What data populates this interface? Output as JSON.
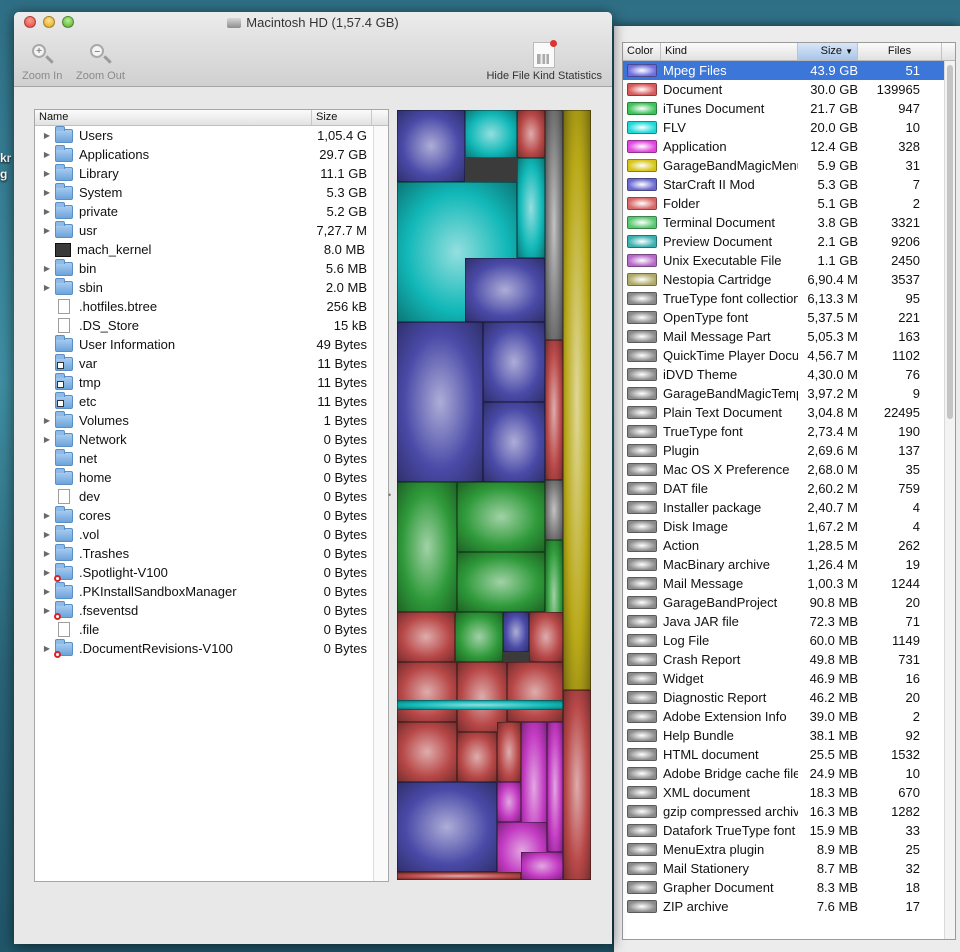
{
  "desktop": {
    "edge_text": [
      "kr",
      "g"
    ]
  },
  "window": {
    "title": "Macintosh HD (1,57.4 GB)",
    "toolbar": {
      "zoom_in": "Zoom In",
      "zoom_out": "Zoom Out",
      "hide_stats": "Hide File Kind Statistics"
    }
  },
  "outline": {
    "columns": {
      "name": "Name",
      "size": "Size"
    },
    "rows": [
      {
        "name": "Users",
        "size": "1,05.4 G",
        "icon": "folder",
        "expandable": true,
        "badge": ""
      },
      {
        "name": "Applications",
        "size": "29.7 GB",
        "icon": "folder",
        "expandable": true,
        "badge": ""
      },
      {
        "name": "Library",
        "size": "11.1 GB",
        "icon": "folder",
        "expandable": true,
        "badge": ""
      },
      {
        "name": "System",
        "size": "5.3 GB",
        "icon": "folder",
        "expandable": true,
        "badge": ""
      },
      {
        "name": "private",
        "size": "5.2 GB",
        "icon": "folder",
        "expandable": true,
        "badge": ""
      },
      {
        "name": "usr",
        "size": "7,27.7 M",
        "icon": "folder",
        "expandable": true,
        "badge": ""
      },
      {
        "name": "mach_kernel",
        "size": "8.0 MB",
        "icon": "exe",
        "expandable": false,
        "badge": ""
      },
      {
        "name": "bin",
        "size": "5.6 MB",
        "icon": "folder",
        "expandable": true,
        "badge": ""
      },
      {
        "name": "sbin",
        "size": "2.0 MB",
        "icon": "folder",
        "expandable": true,
        "badge": ""
      },
      {
        "name": ".hotfiles.btree",
        "size": "256 kB",
        "icon": "doc",
        "expandable": false,
        "badge": ""
      },
      {
        "name": ".DS_Store",
        "size": "15 kB",
        "icon": "doc",
        "expandable": false,
        "badge": ""
      },
      {
        "name": "User Information",
        "size": "49 Bytes",
        "icon": "folder",
        "expandable": false,
        "badge": ""
      },
      {
        "name": "var",
        "size": "11 Bytes",
        "icon": "folder",
        "expandable": false,
        "badge": "alias"
      },
      {
        "name": "tmp",
        "size": "11 Bytes",
        "icon": "folder",
        "expandable": false,
        "badge": "alias"
      },
      {
        "name": "etc",
        "size": "11 Bytes",
        "icon": "folder",
        "expandable": false,
        "badge": "alias"
      },
      {
        "name": "Volumes",
        "size": "1 Bytes",
        "icon": "folder",
        "expandable": true,
        "badge": ""
      },
      {
        "name": "Network",
        "size": "0 Bytes",
        "icon": "folder",
        "expandable": true,
        "badge": ""
      },
      {
        "name": "net",
        "size": "0 Bytes",
        "icon": "folder",
        "expandable": false,
        "badge": ""
      },
      {
        "name": "home",
        "size": "0 Bytes",
        "icon": "folder",
        "expandable": false,
        "badge": ""
      },
      {
        "name": "dev",
        "size": "0 Bytes",
        "icon": "doc",
        "expandable": false,
        "badge": ""
      },
      {
        "name": "cores",
        "size": "0 Bytes",
        "icon": "folder",
        "expandable": true,
        "badge": ""
      },
      {
        "name": ".vol",
        "size": "0 Bytes",
        "icon": "folder",
        "expandable": true,
        "badge": ""
      },
      {
        "name": ".Trashes",
        "size": "0 Bytes",
        "icon": "folder",
        "expandable": true,
        "badge": ""
      },
      {
        "name": ".Spotlight-V100",
        "size": "0 Bytes",
        "icon": "folder",
        "expandable": true,
        "badge": "restricted"
      },
      {
        "name": ".PKInstallSandboxManager",
        "size": "0 Bytes",
        "icon": "folder",
        "expandable": true,
        "badge": ""
      },
      {
        "name": ".fseventsd",
        "size": "0 Bytes",
        "icon": "folder",
        "expandable": true,
        "badge": "restricted"
      },
      {
        "name": ".file",
        "size": "0 Bytes",
        "icon": "doc",
        "expandable": false,
        "badge": ""
      },
      {
        "name": ".DocumentRevisions-V100",
        "size": "0 Bytes",
        "icon": "folder",
        "expandable": true,
        "badge": "restricted"
      }
    ]
  },
  "stats": {
    "columns": {
      "color": "Color",
      "kind": "Kind",
      "size": "Size",
      "files": "Files"
    },
    "rows": [
      {
        "color": "#6f6fe0",
        "kind": "Mpeg Files",
        "size": "43.9 GB",
        "files": "51",
        "selected": true
      },
      {
        "color": "#d85a5a",
        "kind": "Document",
        "size": "30.0 GB",
        "files": "139965"
      },
      {
        "color": "#3ec45a",
        "kind": "iTunes Document",
        "size": "21.7 GB",
        "files": "947"
      },
      {
        "color": "#1fd9d9",
        "kind": "FLV",
        "size": "20.0 GB",
        "files": "10"
      },
      {
        "color": "#e046e0",
        "kind": "Application",
        "size": "12.4 GB",
        "files": "328"
      },
      {
        "color": "#d6c418",
        "kind": "GarageBandMagicMenu",
        "size": "5.9 GB",
        "files": "31"
      },
      {
        "color": "#6a6ad0",
        "kind": "StarCraft II Mod",
        "size": "5.3 GB",
        "files": "7"
      },
      {
        "color": "#d86868",
        "kind": "Folder",
        "size": "5.1 GB",
        "files": "2"
      },
      {
        "color": "#58c870",
        "kind": "Terminal Document",
        "size": "3.8 GB",
        "files": "3321"
      },
      {
        "color": "#3ab0b0",
        "kind": "Preview Document",
        "size": "2.1 GB",
        "files": "9206"
      },
      {
        "color": "#b868c8",
        "kind": "Unix Executable File",
        "size": "1.1 GB",
        "files": "2450"
      },
      {
        "color": "#b0aa68",
        "kind": "Nestopia Cartridge",
        "size": "6,90.4 M",
        "files": "3537"
      },
      {
        "color": "#8a8a8a",
        "kind": "TrueType font collection",
        "size": "6,13.3 M",
        "files": "95"
      },
      {
        "color": "#8a8a8a",
        "kind": "OpenType font",
        "size": "5,37.5 M",
        "files": "221"
      },
      {
        "color": "#8a8a8a",
        "kind": "Mail Message Part",
        "size": "5,05.3 M",
        "files": "163"
      },
      {
        "color": "#8a8a8a",
        "kind": "QuickTime Player Document",
        "size": "4,56.7 M",
        "files": "1102"
      },
      {
        "color": "#8a8a8a",
        "kind": "iDVD Theme",
        "size": "4,30.0 M",
        "files": "76"
      },
      {
        "color": "#8a8a8a",
        "kind": "GarageBandMagicTemplate",
        "size": "3,97.2 M",
        "files": "9"
      },
      {
        "color": "#8a8a8a",
        "kind": "Plain Text Document",
        "size": "3,04.8 M",
        "files": "22495"
      },
      {
        "color": "#8a8a8a",
        "kind": "TrueType font",
        "size": "2,73.4 M",
        "files": "190"
      },
      {
        "color": "#8a8a8a",
        "kind": "Plugin",
        "size": "2,69.6 M",
        "files": "137"
      },
      {
        "color": "#8a8a8a",
        "kind": "Mac OS X Preference",
        "size": "2,68.0 M",
        "files": "35"
      },
      {
        "color": "#8a8a8a",
        "kind": "DAT file",
        "size": "2,60.2 M",
        "files": "759"
      },
      {
        "color": "#8a8a8a",
        "kind": "Installer package",
        "size": "2,40.7 M",
        "files": "4"
      },
      {
        "color": "#8a8a8a",
        "kind": "Disk Image",
        "size": "1,67.2 M",
        "files": "4"
      },
      {
        "color": "#8a8a8a",
        "kind": "Action",
        "size": "1,28.5 M",
        "files": "262"
      },
      {
        "color": "#8a8a8a",
        "kind": "MacBinary archive",
        "size": "1,26.4 M",
        "files": "19"
      },
      {
        "color": "#8a8a8a",
        "kind": "Mail Message",
        "size": "1,00.3 M",
        "files": "1244"
      },
      {
        "color": "#8a8a8a",
        "kind": "GarageBandProject",
        "size": "90.8 MB",
        "files": "20"
      },
      {
        "color": "#8a8a8a",
        "kind": "Java JAR file",
        "size": "72.3 MB",
        "files": "71"
      },
      {
        "color": "#8a8a8a",
        "kind": "Log File",
        "size": "60.0 MB",
        "files": "1149"
      },
      {
        "color": "#8a8a8a",
        "kind": "Crash Report",
        "size": "49.8 MB",
        "files": "731"
      },
      {
        "color": "#8a8a8a",
        "kind": "Widget",
        "size": "46.9 MB",
        "files": "16"
      },
      {
        "color": "#8a8a8a",
        "kind": "Diagnostic Report",
        "size": "46.2 MB",
        "files": "20"
      },
      {
        "color": "#8a8a8a",
        "kind": "Adobe Extension Info",
        "size": "39.0 MB",
        "files": "2"
      },
      {
        "color": "#8a8a8a",
        "kind": "Help Bundle",
        "size": "38.1 MB",
        "files": "92"
      },
      {
        "color": "#8a8a8a",
        "kind": "HTML document",
        "size": "25.5 MB",
        "files": "1532"
      },
      {
        "color": "#8a8a8a",
        "kind": "Adobe Bridge cache file",
        "size": "24.9 MB",
        "files": "10"
      },
      {
        "color": "#8a8a8a",
        "kind": "XML document",
        "size": "18.3 MB",
        "files": "670"
      },
      {
        "color": "#8a8a8a",
        "kind": "gzip compressed archive",
        "size": "16.3 MB",
        "files": "1282"
      },
      {
        "color": "#8a8a8a",
        "kind": "Datafork TrueType font",
        "size": "15.9 MB",
        "files": "33"
      },
      {
        "color": "#8a8a8a",
        "kind": "MenuExtra plugin",
        "size": "8.9 MB",
        "files": "25"
      },
      {
        "color": "#8a8a8a",
        "kind": "Mail Stationery",
        "size": "8.7 MB",
        "files": "32"
      },
      {
        "color": "#8a8a8a",
        "kind": "Grapher Document",
        "size": "8.3 MB",
        "files": "18"
      },
      {
        "color": "#8a8a8a",
        "kind": "ZIP archive",
        "size": "7.6 MB",
        "files": "17"
      }
    ]
  },
  "treemap": {
    "colors": {
      "mpeg": "#4a4aa8",
      "flv": "#12b8b8",
      "itunes": "#2f9a3a",
      "document": "#b84848",
      "application": "#c23ac2",
      "garageband": "#b8a818",
      "gray": "#7a7a7a"
    }
  }
}
